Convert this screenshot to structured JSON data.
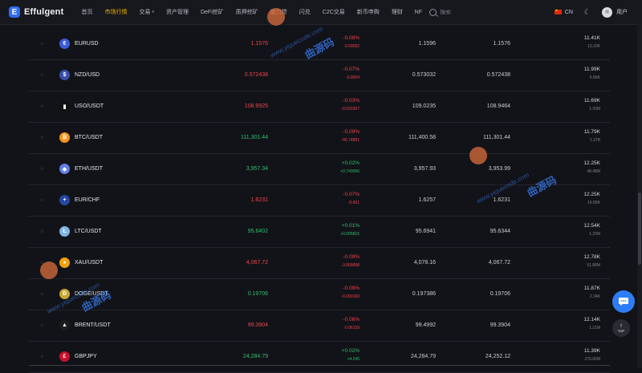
{
  "nav": {
    "logo_letter": "E",
    "brand": "Effulgent",
    "items": [
      {
        "label": "首页",
        "active": false,
        "dropdown": false
      },
      {
        "label": "市场行情",
        "active": true,
        "dropdown": false
      },
      {
        "label": "交易",
        "active": false,
        "dropdown": true
      },
      {
        "label": "资产管理",
        "active": false,
        "dropdown": false
      },
      {
        "label": "DeFi挖矿",
        "active": false,
        "dropdown": false
      },
      {
        "label": "质押挖矿",
        "active": false,
        "dropdown": false
      },
      {
        "label": "助力贷",
        "active": false,
        "dropdown": false
      },
      {
        "label": "闪兑",
        "active": false,
        "dropdown": false
      },
      {
        "label": "C2C交易",
        "active": false,
        "dropdown": false
      },
      {
        "label": "新币申购",
        "active": false,
        "dropdown": false
      },
      {
        "label": "理财",
        "active": false,
        "dropdown": false
      },
      {
        "label": "NF",
        "active": false,
        "dropdown": false
      }
    ],
    "search_placeholder": "搜索",
    "language": "CN",
    "user": "用户"
  },
  "rows": [
    {
      "pair": "EURUSD",
      "coin": "€",
      "coin_color": "#3d5bd9",
      "price": "1.1576",
      "dir": "down",
      "change_pct": "-0.08%",
      "change_abs": "-0.00092",
      "high": "1.1596",
      "low": "1.1576",
      "vol_main": "11.41K",
      "vol_sub": "13.20K"
    },
    {
      "pair": "NZD/USD",
      "coin": "$",
      "coin_color": "#3b4fa8",
      "price": "0.572438",
      "dir": "down",
      "change_pct": "-0.07%",
      "change_abs": "-0.0004",
      "high": "0.573032",
      "low": "0.572438",
      "vol_main": "11.99K",
      "vol_sub": "6.86K"
    },
    {
      "pair": "USO/USDT",
      "coin": "▮",
      "coin_color": "#111111",
      "price": "108.9925",
      "dir": "down",
      "change_pct": "-0.03%",
      "change_abs": "-0.031007",
      "high": "109.0235",
      "low": "108.9464",
      "vol_main": "11.69K",
      "vol_sub": "1.30M"
    },
    {
      "pair": "BTC/USDT",
      "coin": "₿",
      "coin_color": "#f7931a",
      "price": "111,301.44",
      "dir": "up",
      "change_pct": "-0.09%",
      "change_abs": "-95.74881",
      "high": "111,400.58",
      "low": "111,301.44",
      "vol_main": "11.79K",
      "vol_sub": "1.37B"
    },
    {
      "pair": "ETH/USDT",
      "coin": "◆",
      "coin_color": "#627eea",
      "price": "3,957.34",
      "dir": "up",
      "change_pct": "+0.02%",
      "change_abs": "+0.743056",
      "high": "3,957.93",
      "low": "3,953.99",
      "vol_main": "12.25K",
      "vol_sub": "48.48M"
    },
    {
      "pair": "EUR/CHF",
      "coin": "+",
      "coin_color": "#2546a3",
      "price": "1.6231",
      "dir": "down",
      "change_pct": "-0.07%",
      "change_abs": "-0.001",
      "high": "1.6257",
      "low": "1.6231",
      "vol_main": "12.25K",
      "vol_sub": "19.89K"
    },
    {
      "pair": "LTC/USDT",
      "coin": "Ł",
      "coin_color": "#7fb6e6",
      "price": "95.6402",
      "dir": "up",
      "change_pct": "+0.01%",
      "change_abs": "+0.005815",
      "high": "95.6941",
      "low": "95.6344",
      "vol_main": "12.54K",
      "vol_sub": "1.20M"
    },
    {
      "pair": "XAU/USDT",
      "coin": "●",
      "coin_color": "#f1a20f",
      "price": "4,067.72",
      "dir": "down",
      "change_pct": "-0.09%",
      "change_abs": "-3.809898",
      "high": "4,078.16",
      "low": "4,067.72",
      "vol_main": "12.78K",
      "vol_sub": "51.88M"
    },
    {
      "pair": "DOGE/USDT",
      "coin": "Ð",
      "coin_color": "#c9a633",
      "price": "0.19706",
      "dir": "up",
      "change_pct": "-0.09%",
      "change_abs": "-0.000169",
      "high": "0.197386",
      "low": "0.19706",
      "vol_main": "11.87K",
      "vol_sub": "2.34K"
    },
    {
      "pair": "BRENT/USDT",
      "coin": "▲",
      "coin_color": "#1d1d1d",
      "price": "99.3904",
      "dir": "down",
      "change_pct": "-0.06%",
      "change_abs": "-0.06109",
      "high": "99.4992",
      "low": "99.3904",
      "vol_main": "12.14K",
      "vol_sub": "1.21M"
    },
    {
      "pair": "GBPJPY",
      "coin": "£",
      "coin_color": "#c8102e",
      "price": "24,284.79",
      "dir": "up",
      "change_pct": "+0.02%",
      "change_abs": "+4.245",
      "high": "24,284.79",
      "low": "24,252.12",
      "vol_main": "11.39K",
      "vol_sub": "276.80M"
    }
  ],
  "float": {
    "top_label": "TOP"
  },
  "watermark": {
    "text": "曲源码",
    "url": "www.yiquecode.com"
  }
}
